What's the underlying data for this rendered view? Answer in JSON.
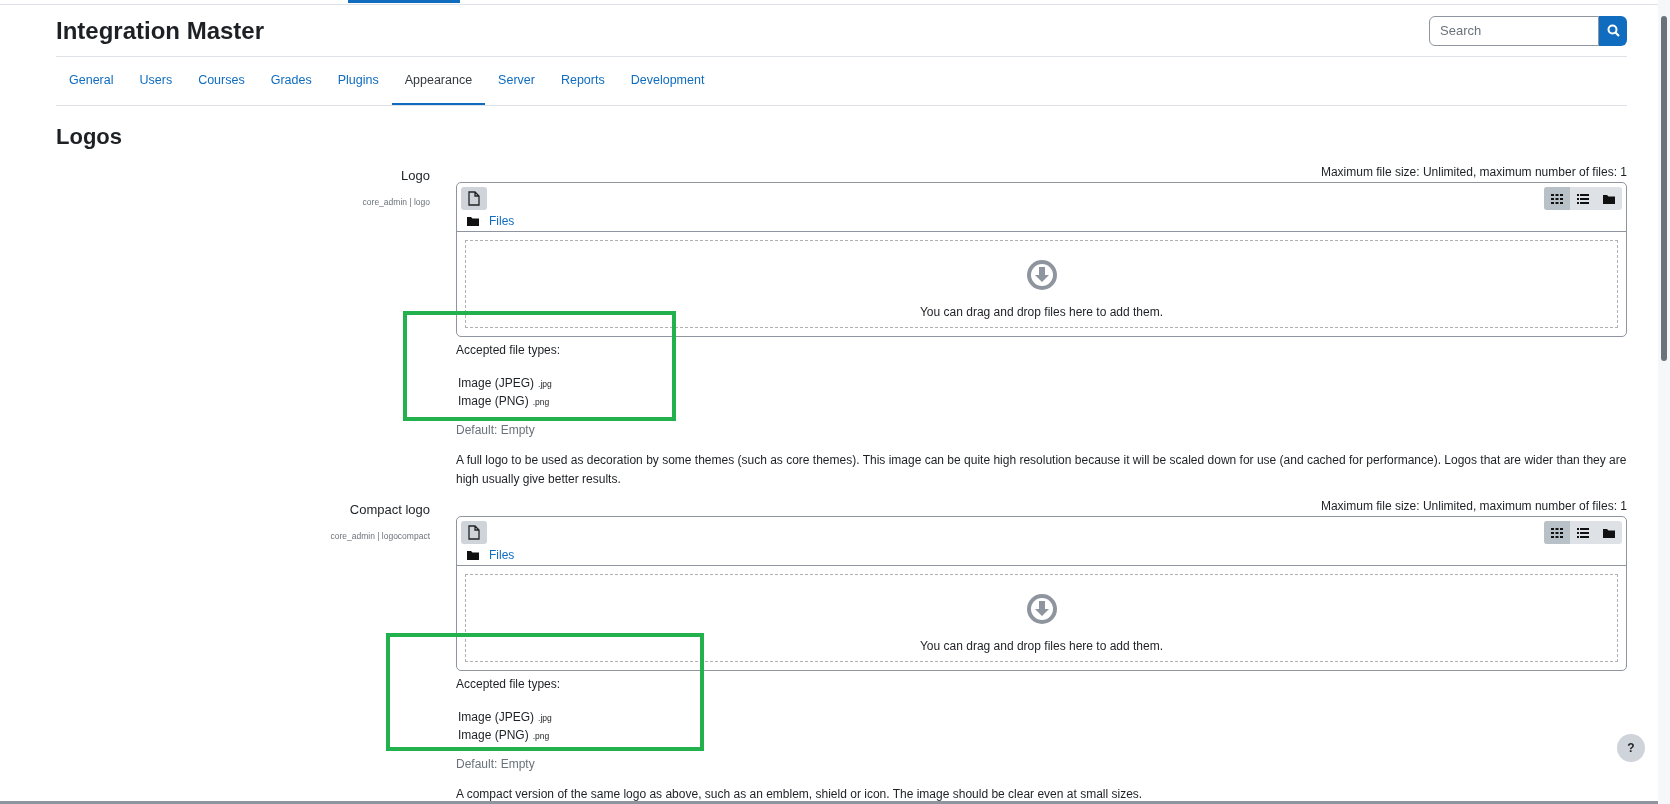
{
  "site_title": "Integration Master",
  "search": {
    "placeholder": "Search"
  },
  "tabs": [
    {
      "label": "General",
      "selected": false
    },
    {
      "label": "Users",
      "selected": false
    },
    {
      "label": "Courses",
      "selected": false
    },
    {
      "label": "Grades",
      "selected": false
    },
    {
      "label": "Plugins",
      "selected": false
    },
    {
      "label": "Appearance",
      "selected": true
    },
    {
      "label": "Server",
      "selected": false
    },
    {
      "label": "Reports",
      "selected": false
    },
    {
      "label": "Development",
      "selected": false
    }
  ],
  "heading": "Logos",
  "settings": [
    {
      "label": "Logo",
      "setting_id": "core_admin | logo",
      "limits": "Maximum file size: Unlimited, maximum number of files: 1",
      "files_link": "Files",
      "drop_hint": "You can drag and drop files here to add them.",
      "accepted_label": "Accepted file types:",
      "file_types": [
        {
          "name": "Image (JPEG)",
          "ext": ".jpg"
        },
        {
          "name": "Image (PNG)",
          "ext": ".png"
        }
      ],
      "default": "Default: Empty",
      "description": "A full logo to be used as decoration by some themes (such as core themes). This image can be quite high resolution because it will be scaled down for use (and cached for performance). Logos that are wider than they are high usually give better results."
    },
    {
      "label": "Compact logo",
      "setting_id": "core_admin | logocompact",
      "limits": "Maximum file size: Unlimited, maximum number of files: 1",
      "files_link": "Files",
      "drop_hint": "You can drag and drop files here to add them.",
      "accepted_label": "Accepted file types:",
      "file_types": [
        {
          "name": "Image (JPEG)",
          "ext": ".jpg"
        },
        {
          "name": "Image (PNG)",
          "ext": ".png"
        }
      ],
      "default": "Default: Empty",
      "description": "A compact version of the same logo as above, such as an emblem, shield or icon. The image should be clear even at small sizes."
    }
  ],
  "help_button": "?"
}
